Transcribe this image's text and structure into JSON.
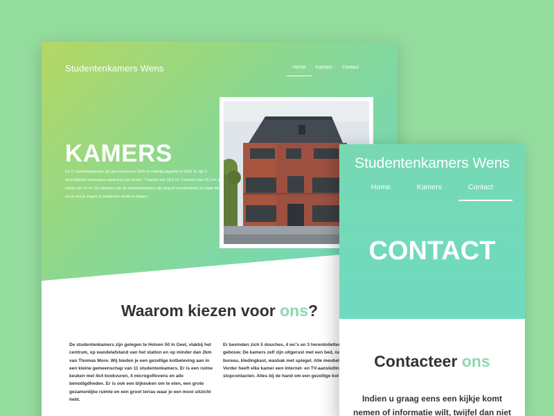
{
  "colors": {
    "background": "#94dc9e",
    "accent": "#8dd7b2",
    "hero_gradient_start": "#b4d763",
    "hero_gradient_end": "#6ad8c4",
    "text": "#333333"
  },
  "desktop": {
    "logo": "Studentenkamers Wens",
    "nav": [
      {
        "label": "Home",
        "active": true
      },
      {
        "label": "Kamers",
        "active": false
      },
      {
        "label": "Contact",
        "active": false
      }
    ],
    "hero": {
      "title": "KAMERS",
      "intro": "De 11 studentenkamers zijn gerenoveerd in 2009 en volledig opgefrist in 2020. Er zijn 3 verschillende kamertypes waaruit je kan kiezen: 7 kamers van 18,5 m², 3 kamers van 15,2 m² en 1 kamer van 14 m². De uitbaters van de studentenkamers zijn jong en meedenkend, en staan klaar om je met je vragen of problemen verder te helpen."
    },
    "why": {
      "title_prefix": "Waarom kiezen voor ",
      "title_accent": "ons",
      "title_suffix": "?",
      "col1": "De studentenkamers zijn gelegen te Holven 50 in Geel, vlakbij het centrum, op wandelafstand van het station en op minder dan 2km van Thomas More. Wij bieden je een gezellige kotbeleving aan in een kleine gemeenschap van 11 studentenkamers. Er is een ruime keuken met 4x4 kookvuren, 4 microgolfovens en alle benodigdheden. Er is ook een bijkeuken om te eten, een grote gezamenlijke ruimte en een groot terras waar je een mooi uitzicht hebt.",
      "col2": "Er bevinden zich 5 douches, 4 wc's en 3 herentoiletten in het gebouw. De kamers zelf zijn uitgerust met een bed, nachtkastje, bureau, kledingkast, wasbak met spiegel. Alle meubels zijn nieuw. Verder heeft elke kamer een internet- en TV-aansluiting en stopcontacten. Alles bij de hand om een gezellige kot te beleven."
    }
  },
  "mobile": {
    "logo": "Studentenkamers Wens",
    "nav": [
      {
        "label": "Home",
        "active": false
      },
      {
        "label": "Kamers",
        "active": false
      },
      {
        "label": "Contact",
        "active": true
      }
    ],
    "hero": {
      "title": "CONTACT"
    },
    "section": {
      "title_prefix": "Contacteer ",
      "title_accent": "ons",
      "text": "Indien u graag eens een kijkje komt nemen of informatie wilt, twijfel dan niet om ons te"
    }
  }
}
